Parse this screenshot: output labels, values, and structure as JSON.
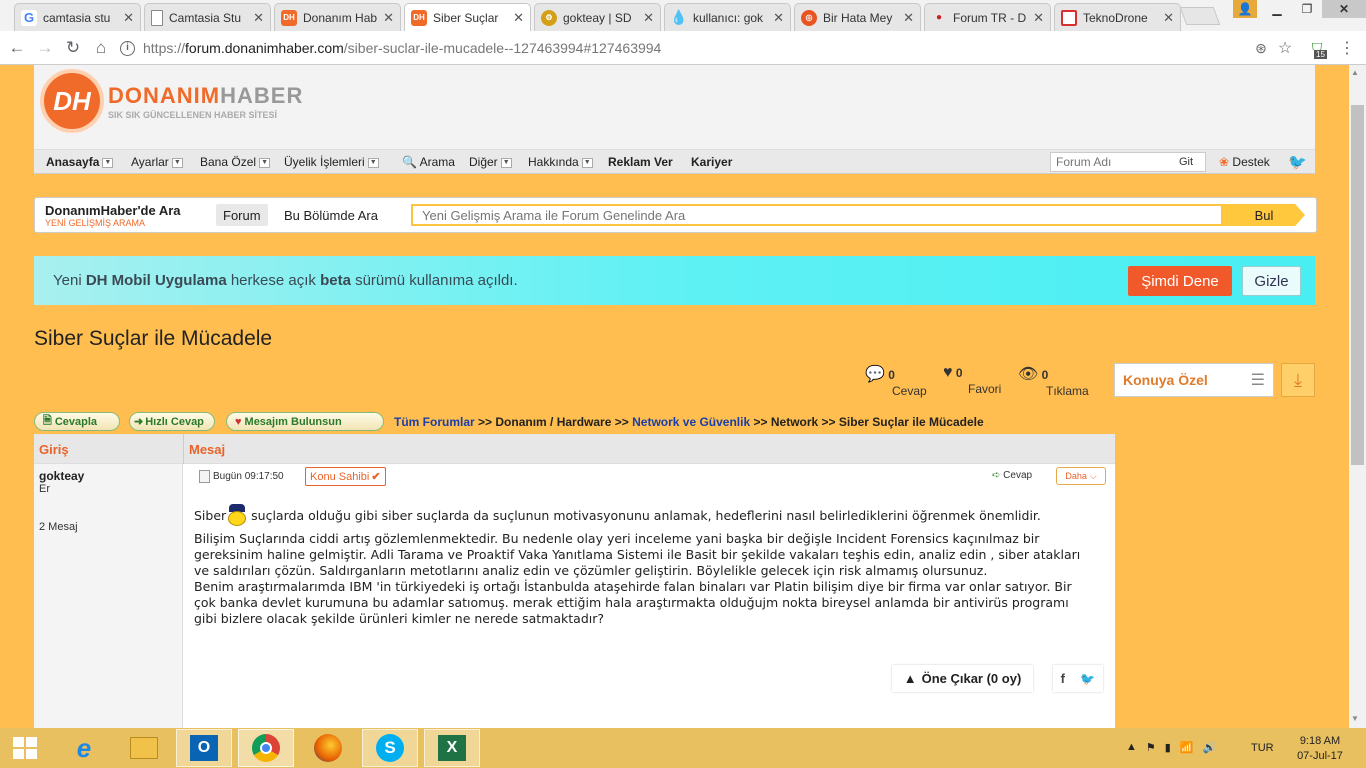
{
  "browser": {
    "tabs": [
      {
        "title": "camtasia stu",
        "icon": "google-icon",
        "color": "#4285f4",
        "glyph": "G"
      },
      {
        "title": "Camtasia Stu",
        "icon": "document-icon",
        "color": "#888888",
        "glyph": ""
      },
      {
        "title": "Donanım Hab",
        "icon": "dh-icon",
        "color": "#f06a2a",
        "glyph": "DH"
      },
      {
        "title": "Siber Suçlar",
        "icon": "dh-icon",
        "color": "#f06a2a",
        "glyph": "DH"
      },
      {
        "title": "gokteay | SD",
        "icon": "sd-icon",
        "color": "#d4a017",
        "glyph": "⚙"
      },
      {
        "title": "kullanıcı: gok",
        "icon": "drop-icon",
        "color": "#6cbd3c",
        "glyph": "●"
      },
      {
        "title": "Bir Hata Mey",
        "icon": "ubuntu-icon",
        "color": "#e95420",
        "glyph": "◎"
      },
      {
        "title": "Forum TR - D",
        "icon": "forum-icon",
        "color": "#cc2222",
        "glyph": "●"
      },
      {
        "title": "TeknoDrone",
        "icon": "teknodrone-icon",
        "color": "#d9302f",
        "glyph": "▣"
      }
    ],
    "url_prefix": "https://",
    "url_domain": "forum.donanimhaber.com",
    "url_path": "/siber-suclar-ile-mucadele--127463994#127463994",
    "ext_badge": "15"
  },
  "site": {
    "logo_initials": "DH",
    "logo_name_a": "DONANIM",
    "logo_name_b": "HABER",
    "logo_tagline": "SIK SIK GÜNCELLENEN HABER SİTESİ",
    "menu": {
      "anasayfa": "Anasayfa",
      "ayarlar": "Ayarlar",
      "bana_ozel": "Bana Özel",
      "uyelik": "Üyelik İşlemleri",
      "arama": "Arama",
      "diger": "Diğer",
      "hakkinda": "Hakkında",
      "reklam": "Reklam Ver",
      "kariyer": "Kariyer",
      "forum_placeholder": "Forum Adı",
      "git": "Git",
      "destek": "Destek"
    },
    "search": {
      "title": "DonanımHaber'de Ara",
      "subtitle": "YENİ GELİŞMİŞ ARAMA",
      "tab_forum": "Forum",
      "tab_bolum": "Bu Bölümde Ara",
      "placeholder": "Yeni Gelişmiş Arama ile Forum Genelinde Ara",
      "button": "Bul"
    },
    "banner": {
      "t1": "Yeni ",
      "t2": "DH Mobil Uygulama",
      "t3": " herkese açık ",
      "t4": "beta",
      "t5": " sürümü kullanıma açıldı.",
      "try": "Şimdi Dene",
      "hide": "Gizle"
    }
  },
  "topic": {
    "title": "Siber Suçlar ile Mücadele",
    "stats": [
      {
        "value": "0",
        "label": "Cevap",
        "icon": "chat-icon"
      },
      {
        "value": "0",
        "label": "Favori",
        "icon": "heart-icon"
      },
      {
        "value": "0",
        "label": "Tıklama",
        "icon": "eye-icon"
      }
    ],
    "konuya_ozel": "Konuya Özel",
    "buttons": {
      "cevapla": "Cevapla",
      "hizli": "Hızlı Cevap",
      "mesajim": "Mesajım Bulunsun"
    },
    "breadcrumb": {
      "all": "Tüm Forumlar",
      "sep": ">>",
      "b1": "Donanım / Hardware",
      "b2": "Network ve Güvenlik",
      "b3": "Network",
      "b4": "Siber Suçlar ile Mücadele"
    },
    "head_giris": "Giriş",
    "head_mesaj": "Mesaj"
  },
  "post": {
    "author": "gokteay",
    "rank": "Er",
    "msg_count": "2 Mesaj",
    "date": "Bugün 09:17:50",
    "owner_badge": "Konu Sahibi",
    "reply": "Cevap",
    "more": "Daha",
    "p1a": "Siber",
    "p1b": " suçlarda olduğu gibi siber suçlarda da suçlunun motivasyonunu anlamak, hedeflerini nasıl belirlediklerini öğrenmek önemlidir.",
    "p2": "Bilişim Suçlarında ciddi artış gözlemlenmektedir. Bu nedenle olay yeri inceleme yani başka bir değişle Incident Forensics kaçınılmaz bir gereksinim haline gelmiştir. Adli Tarama ve Proaktif Vaka Yanıtlama Sistemi ile Basit bir şekilde vakaları teşhis edin, analiz edin , siber atakları ve saldırıları çözün. Saldırganların metotlarını analiz edin ve çözümler geliştirin. Böylelikle gelecek için risk almamış olursunuz.",
    "p3": "Benim araştırmalarımda IBM 'in türkiyedeki iş ortağı İstanbulda ataşehirde falan binaları var Platin bilişim diye bir firma var onlar satıyor. Bir çok banka devlet kurumuna bu adamlar satıomuş. merak ettiğim hala araştırmakta olduğujm nokta bireysel anlamda bir antivirüs programı gibi bizlere olacak şekilde ürünleri kimler ne nerede satmaktadır?",
    "promote": "Öne Çıkar (0 oy)"
  },
  "taskbar": {
    "lang": "TUR",
    "time": "9:18 AM",
    "date": "07-Jul-17"
  }
}
